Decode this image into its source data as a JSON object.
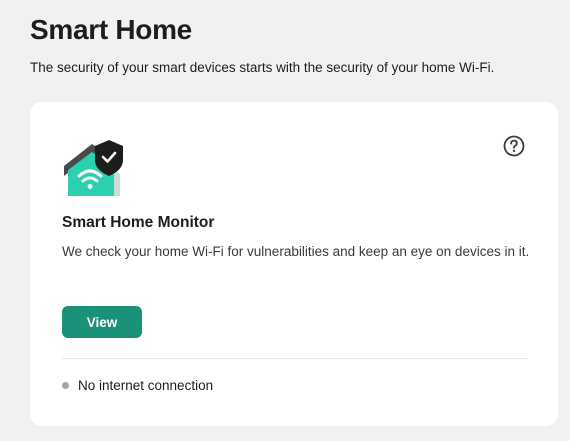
{
  "header": {
    "title": "Smart Home",
    "subtitle": "The security of your smart devices starts with the security of your home Wi-Fi."
  },
  "card": {
    "icon": "smart-home-shield-icon",
    "help_icon": "help-icon",
    "title": "Smart Home Monitor",
    "description": "We check your home Wi-Fi for vulnerabilities and keep an eye on devices in it.",
    "button_label": "View",
    "status": {
      "text": "No internet connection",
      "indicator_color": "#a6a6a6"
    }
  },
  "colors": {
    "accent": "#1a9179",
    "icon_teal": "#2ccfb0",
    "background": "#f1f1f3",
    "card": "#ffffff"
  }
}
